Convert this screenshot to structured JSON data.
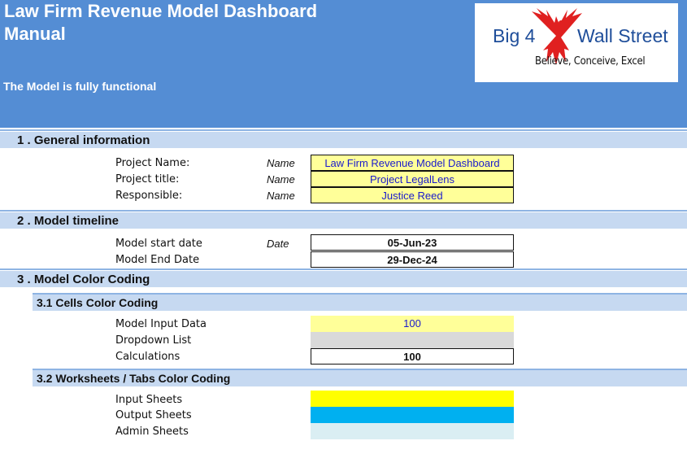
{
  "header": {
    "title_line1": "Law Firm Revenue Model Dashboard",
    "title_line2": "Manual",
    "subtitle": "The Model is fully functional"
  },
  "logo": {
    "left_text": "Big 4",
    "right_text": "Wall Street",
    "tagline": "Believe, Conceive, Excel",
    "icon": "eagle-icon",
    "colors": {
      "text": "#1f4e9a",
      "eagle": "#e02020"
    }
  },
  "sections": {
    "general": {
      "title": "1 . General information",
      "rows": [
        {
          "label": "Project Name:",
          "type": "Name",
          "value": "Law Firm Revenue Model Dashboard"
        },
        {
          "label": "Project title:",
          "type": "Name",
          "value": "Project LegalLens"
        },
        {
          "label": "Responsible:",
          "type": "Name",
          "value": "Justice Reed"
        }
      ]
    },
    "timeline": {
      "title": "2 . Model timeline",
      "rows": [
        {
          "label": "Model start date",
          "type": "Date",
          "value": "05-Jun-23"
        },
        {
          "label": "Model End Date",
          "type": "",
          "value": "29-Dec-24"
        }
      ]
    },
    "coding": {
      "title": "3 . Model Color Coding",
      "cells": {
        "title": "3.1 Cells Color Coding",
        "rows": [
          {
            "label": "Model Input Data",
            "value": "100"
          },
          {
            "label": "Dropdown List",
            "value": ""
          },
          {
            "label": "Calculations",
            "value": "100"
          }
        ]
      },
      "tabs": {
        "title": "3.2 Worksheets / Tabs Color Coding",
        "rows": [
          {
            "label": "Input Sheets",
            "color": "#ffff00"
          },
          {
            "label": "Output Sheets",
            "color": "#00b0f0"
          },
          {
            "label": "Admin Sheets",
            "color": "#daeef3"
          }
        ]
      }
    }
  },
  "colors": {
    "header_bg": "#548dd4",
    "section_bg": "#c6d9f1",
    "input_cell": "#ffff99",
    "input_text": "#1a1acc",
    "dropdown_cell": "#d9d9d9"
  }
}
